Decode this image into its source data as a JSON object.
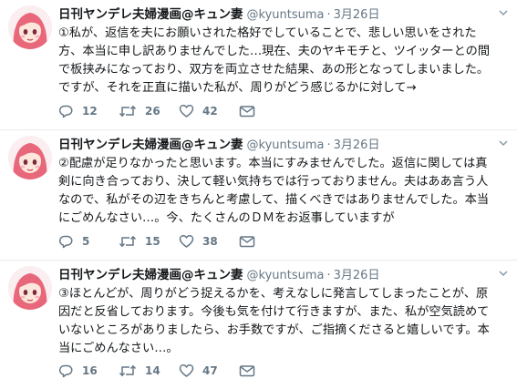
{
  "tweets": [
    {
      "display_name": "日刊ヤンデレ夫婦漫画@キュン妻",
      "handle": "@kyuntsuma",
      "separator": "·",
      "date": "3月26日",
      "lines": [
        "①私が、返信を夫にお願いされた格好でしていることで、悲しい思いをされた",
        "方、本当に申し訳ありませんでした…現在、夫のヤキモチと、ツイッターとの間",
        "で板挟みになっており、双方を両立させた結果、あの形となってしまいました。",
        "ですが、それを正直に描いた私が、周りがどう感じるかに対して→"
      ],
      "reply_count": "12",
      "retweet_count": "26",
      "like_count": "42"
    },
    {
      "display_name": "日刊ヤンデレ夫婦漫画@キュン妻",
      "handle": "@kyuntsuma",
      "separator": "·",
      "date": "3月26日",
      "lines": [
        "②配慮が足りなかったと思います。本当にすみませんでした。返信に関しては真",
        "剣に向き合っており、決して軽い気持ちでは行っておりません。夫はああ言う人",
        "なので、私がその辺をきちんと考慮して、描くべきではありませんでした。本当",
        "にごめんなさい…。今、たくさんのＤＭをお返事していますが"
      ],
      "reply_count": "5",
      "retweet_count": "15",
      "like_count": "38"
    },
    {
      "display_name": "日刊ヤンデレ夫婦漫画@キュン妻",
      "handle": "@kyuntsuma",
      "separator": "·",
      "date": "3月26日",
      "lines": [
        "③ほとんどが、周りがどう捉えるかを、考えなしに発言してしまったことが、原",
        "因だと反省しております。今後も気を付けて行きますが、また、私が空気読めて",
        "いないところがありましたら、お手数ですが、ご指摘くださると嬉しいです。本",
        "当にごめんなさい…。"
      ],
      "reply_count": "16",
      "retweet_count": "14",
      "like_count": "47"
    }
  ],
  "icons": {
    "reply": "reply-icon",
    "retweet": "retweet-icon",
    "like": "heart-icon",
    "dm": "mail-icon",
    "menu": "chevron-down-icon"
  },
  "colors": {
    "icon_gray": "#657786",
    "text": "#14171a",
    "divider": "#e6ecf0",
    "avatar_hair": "#e8677a"
  }
}
